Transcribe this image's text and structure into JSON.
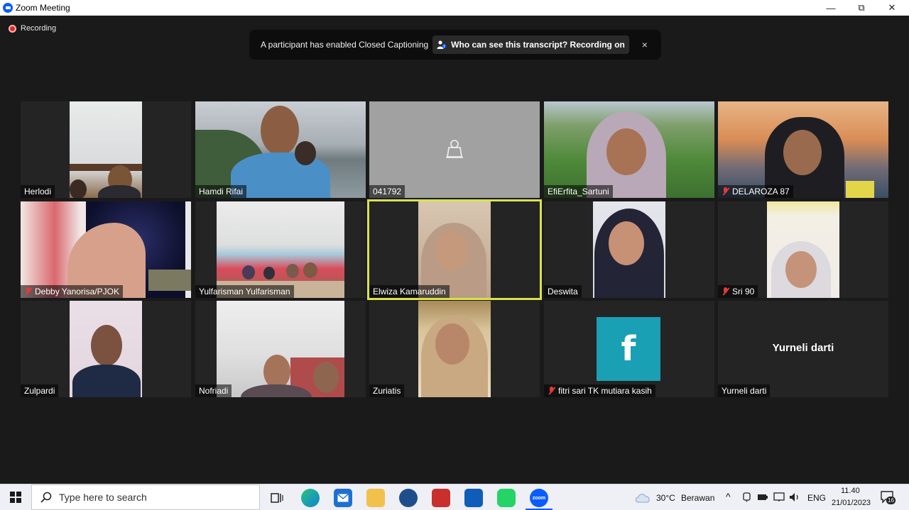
{
  "window": {
    "title": "Zoom Meeting",
    "minimize": "—",
    "restore": "⧉",
    "close": "✕"
  },
  "recording": {
    "label": "Recording"
  },
  "banner": {
    "message": "A participant has enabled Closed Captioning",
    "action": "Who can see this transcript? Recording on",
    "close": "×"
  },
  "participants": [
    {
      "name": "Herlodi",
      "muted": false
    },
    {
      "name": "Hamdi Rifai",
      "muted": false
    },
    {
      "name": "041792",
      "muted": false
    },
    {
      "name": "EfiErfita_Sartuni",
      "muted": false
    },
    {
      "name": "DELAROZA 87",
      "muted": true
    },
    {
      "name": "Debby Yanorisa/PJOK",
      "muted": true
    },
    {
      "name": "Yulfarisman Yulfarisman",
      "muted": false
    },
    {
      "name": "Elwiza Kamaruddin",
      "muted": false
    },
    {
      "name": "Deswita",
      "muted": false
    },
    {
      "name": "Sri 90",
      "muted": true
    },
    {
      "name": "Zulpardi",
      "muted": false
    },
    {
      "name": "Nofriadi",
      "muted": false
    },
    {
      "name": "Zuriatis",
      "muted": false
    },
    {
      "name": "fitri sari  TK mutiara kasih",
      "muted": true
    },
    {
      "name": "Yurneli darti",
      "muted": false
    }
  ],
  "tiles": {
    "center_name": "Yurneli darti",
    "avatar_letter": "f"
  },
  "taskbar": {
    "search_placeholder": "Type here to search",
    "weather_temp": "30°C",
    "weather_desc": "Berawan",
    "language": "ENG",
    "time": "11.40",
    "date": "21/01/2023",
    "notification_count": "16",
    "zoom_label": "zoom"
  },
  "colors": {
    "active_speaker_border": "#d9e34a",
    "recording_red": "#e02828",
    "facebook_tile": "#1aa0b4"
  }
}
